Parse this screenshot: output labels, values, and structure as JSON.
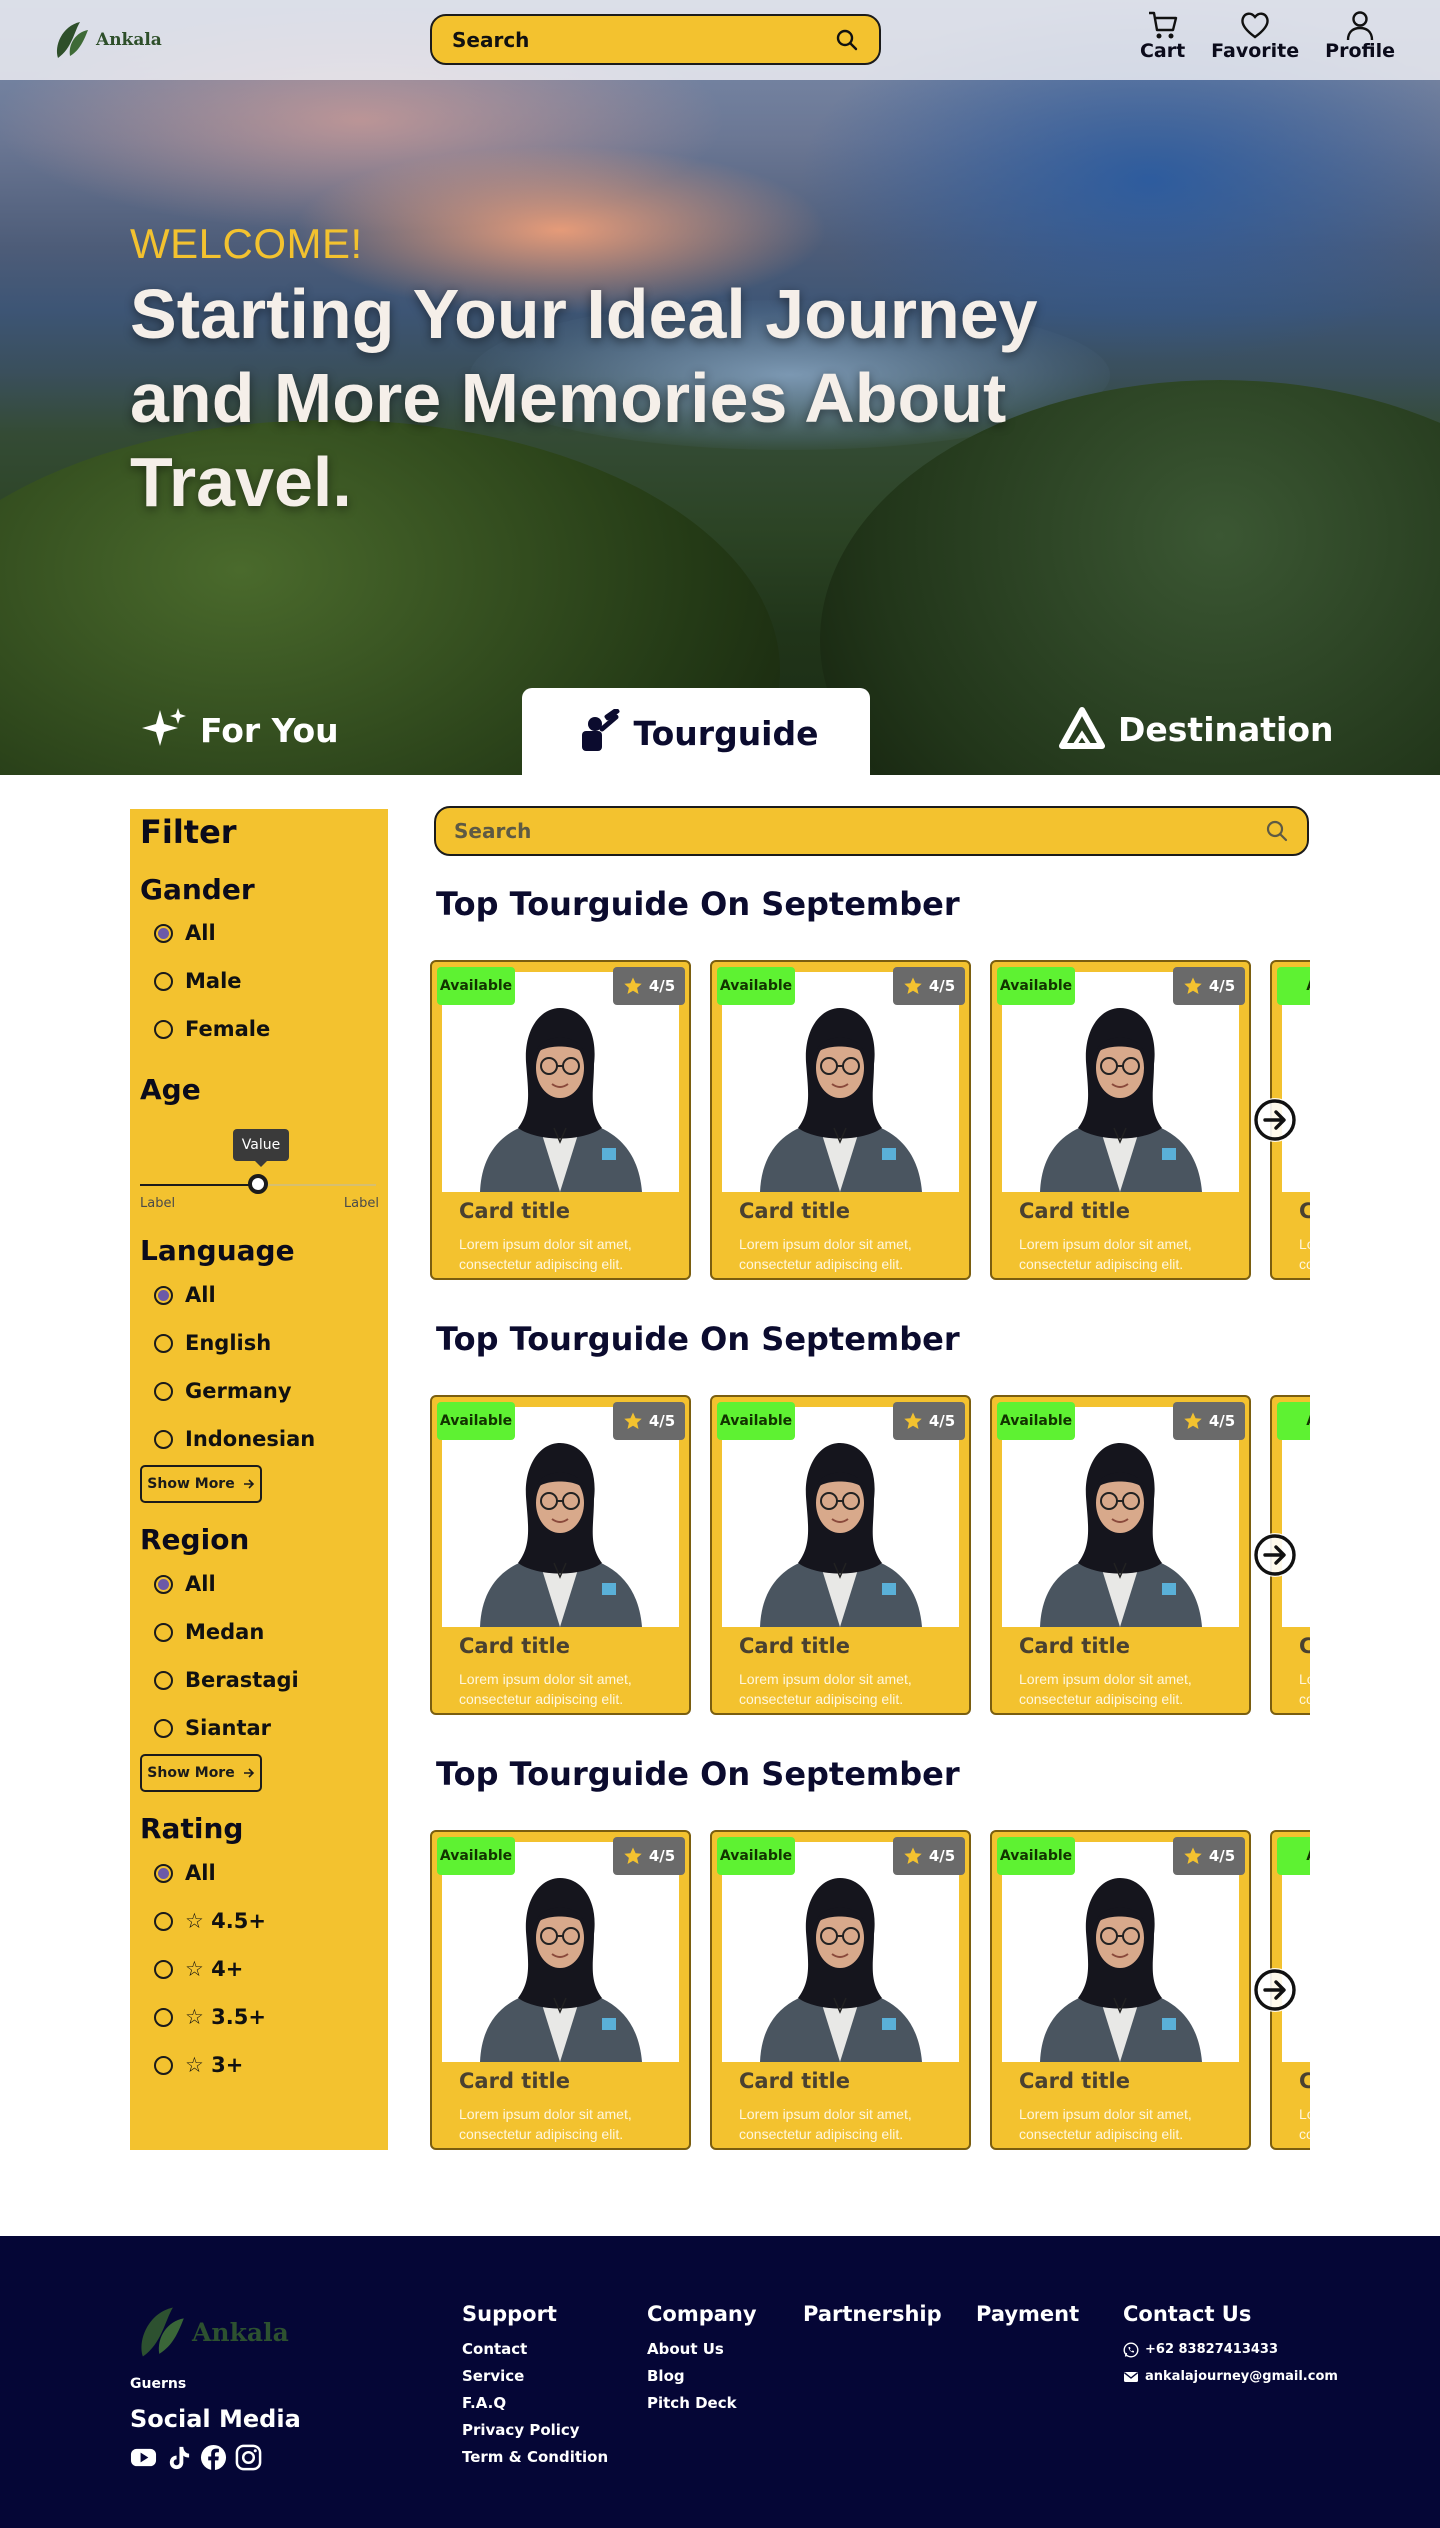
{
  "header": {
    "logo_text": "Ankala",
    "search_placeholder": "Search",
    "nav": [
      {
        "label": "Cart",
        "icon": "cart-icon"
      },
      {
        "label": "Favorite",
        "icon": "heart-icon"
      },
      {
        "label": "Profile",
        "icon": "user-icon"
      }
    ]
  },
  "hero": {
    "welcome": "WELCOME!",
    "headline": "Starting Your Ideal Journey and More Memories About Travel."
  },
  "tabs": [
    {
      "label": "For You",
      "icon": "sparkle-icon",
      "active": false
    },
    {
      "label": "Tourguide",
      "icon": "tourguide-icon",
      "active": true
    },
    {
      "label": "Destination",
      "icon": "mountain-icon",
      "active": false
    }
  ],
  "filter": {
    "title": "Filter",
    "gender": {
      "title": "Gander",
      "options": [
        "All",
        "Male",
        "Female"
      ],
      "selected": "All"
    },
    "age": {
      "title": "Age",
      "tooltip": "Value",
      "min_label": "Label",
      "max_label": "Label",
      "value_fraction": 0.5
    },
    "language": {
      "title": "Language",
      "options": [
        "All",
        "English",
        "Germany",
        "Indonesian"
      ],
      "selected": "All",
      "show_more": "Show More"
    },
    "region": {
      "title": "Region",
      "options": [
        "All",
        "Medan",
        "Berastagi",
        "Siantar"
      ],
      "selected": "All",
      "show_more": "Show More"
    },
    "rating": {
      "title": "Rating",
      "options": [
        "All",
        "☆ 4.5+",
        "☆ 4+",
        "☆ 3.5+",
        "☆ 3+"
      ],
      "selected": "All"
    }
  },
  "content": {
    "search_placeholder": "Search",
    "sections": [
      {
        "title": "Top Tourguide On September"
      },
      {
        "title": "Top Tourguide On September"
      },
      {
        "title": "Top Tourguide On September"
      }
    ],
    "card": {
      "badge": "Available",
      "rating": "4/5",
      "title": "Card title",
      "desc": "Lorem ipsum dolor sit amet, consectetur adipiscing elit.",
      "partial_title": "C",
      "partial_badge": "Av"
    }
  },
  "footer": {
    "logo_text": "Ankala",
    "brand_sub": "Guerns",
    "social_title": "Social Media",
    "social_icons": [
      "youtube-icon",
      "tiktok-icon",
      "facebook-icon",
      "instagram-icon"
    ],
    "support": {
      "title": "Support",
      "links": [
        "Contact",
        "Service",
        "F.A.Q",
        "Privacy Policy",
        "Term & Condition"
      ]
    },
    "company": {
      "title": "Company",
      "links": [
        "About Us",
        "Blog",
        "Pitch Deck"
      ]
    },
    "partnership": {
      "title": "Partnership"
    },
    "payment": {
      "title": "Payment"
    },
    "contact": {
      "title": "Contact Us",
      "phone": "+62 83827413433",
      "email": "ankalajourney@gmail.com"
    }
  },
  "colors": {
    "accent": "#f3c22f",
    "navy": "#050636",
    "available": "#5ef232"
  }
}
